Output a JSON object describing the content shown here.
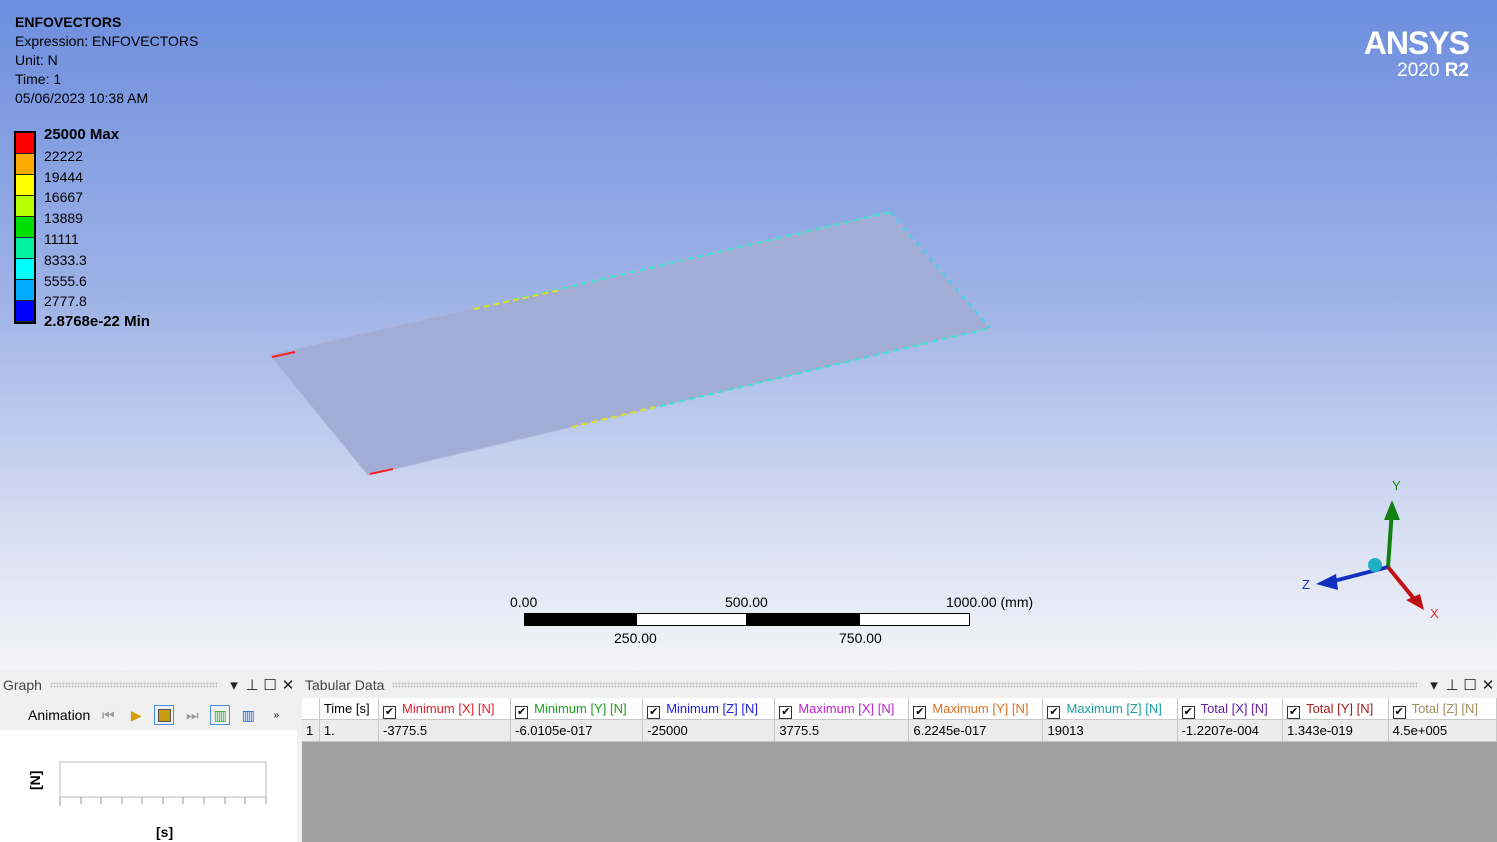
{
  "result": {
    "title": "ENFOVECTORS",
    "expression": "Expression: ENFOVECTORS",
    "unit": "Unit: N",
    "time": "Time: 1",
    "date": "05/06/2023 10:38 AM"
  },
  "legend": {
    "labels": [
      "25000 Max",
      "22222",
      "19444",
      "16667",
      "13889",
      "11111",
      "8333.3",
      "5555.6",
      "2777.8",
      "2.8768e-22 Min"
    ],
    "colors": [
      "#ff0000",
      "#ffaa00",
      "#ffff00",
      "#b4ff00",
      "#00e000",
      "#00f0a0",
      "#00ffff",
      "#00aaff",
      "#0000ff"
    ]
  },
  "logo": {
    "brand": "ANSYS",
    "version": "2020",
    "release": "R2"
  },
  "scale": {
    "top": [
      "0.00",
      "500.00",
      "1000.00 (mm)"
    ],
    "bottom": [
      "250.00",
      "750.00"
    ]
  },
  "triad": {
    "x": "X",
    "y": "Y",
    "z": "Z"
  },
  "graph": {
    "title": "Graph",
    "animation": "Animation",
    "y_label": "[N]",
    "x_label": "[s]"
  },
  "tabular": {
    "title": "Tabular Data",
    "columns": [
      {
        "label": "Time [s]",
        "color": "#000000",
        "check": false
      },
      {
        "label": "Minimum [X] [N]",
        "color": "#e0202a",
        "check": true
      },
      {
        "label": "Minimum [Y] [N]",
        "color": "#20a020",
        "check": true
      },
      {
        "label": "Minimum [Z] [N]",
        "color": "#2020e0",
        "check": true
      },
      {
        "label": "Maximum [X] [N]",
        "color": "#c020d0",
        "check": true
      },
      {
        "label": "Maximum [Y] [N]",
        "color": "#e07020",
        "check": true
      },
      {
        "label": "Maximum [Z] [N]",
        "color": "#20a0a0",
        "check": true
      },
      {
        "label": "Total [X] [N]",
        "color": "#6020a0",
        "check": true
      },
      {
        "label": "Total [Y] [N]",
        "color": "#a02020",
        "check": true
      },
      {
        "label": "Total [Z] [N]",
        "color": "#a09060",
        "check": true
      }
    ],
    "rows": [
      {
        "index": "1",
        "cells": [
          "1.",
          "-3775.5",
          "-6.0105e-017",
          "-25000",
          "3775.5",
          "6.2245e-017",
          "19013",
          "-1.2207e-004",
          "1.343e-019",
          "4.5e+005"
        ]
      }
    ]
  }
}
